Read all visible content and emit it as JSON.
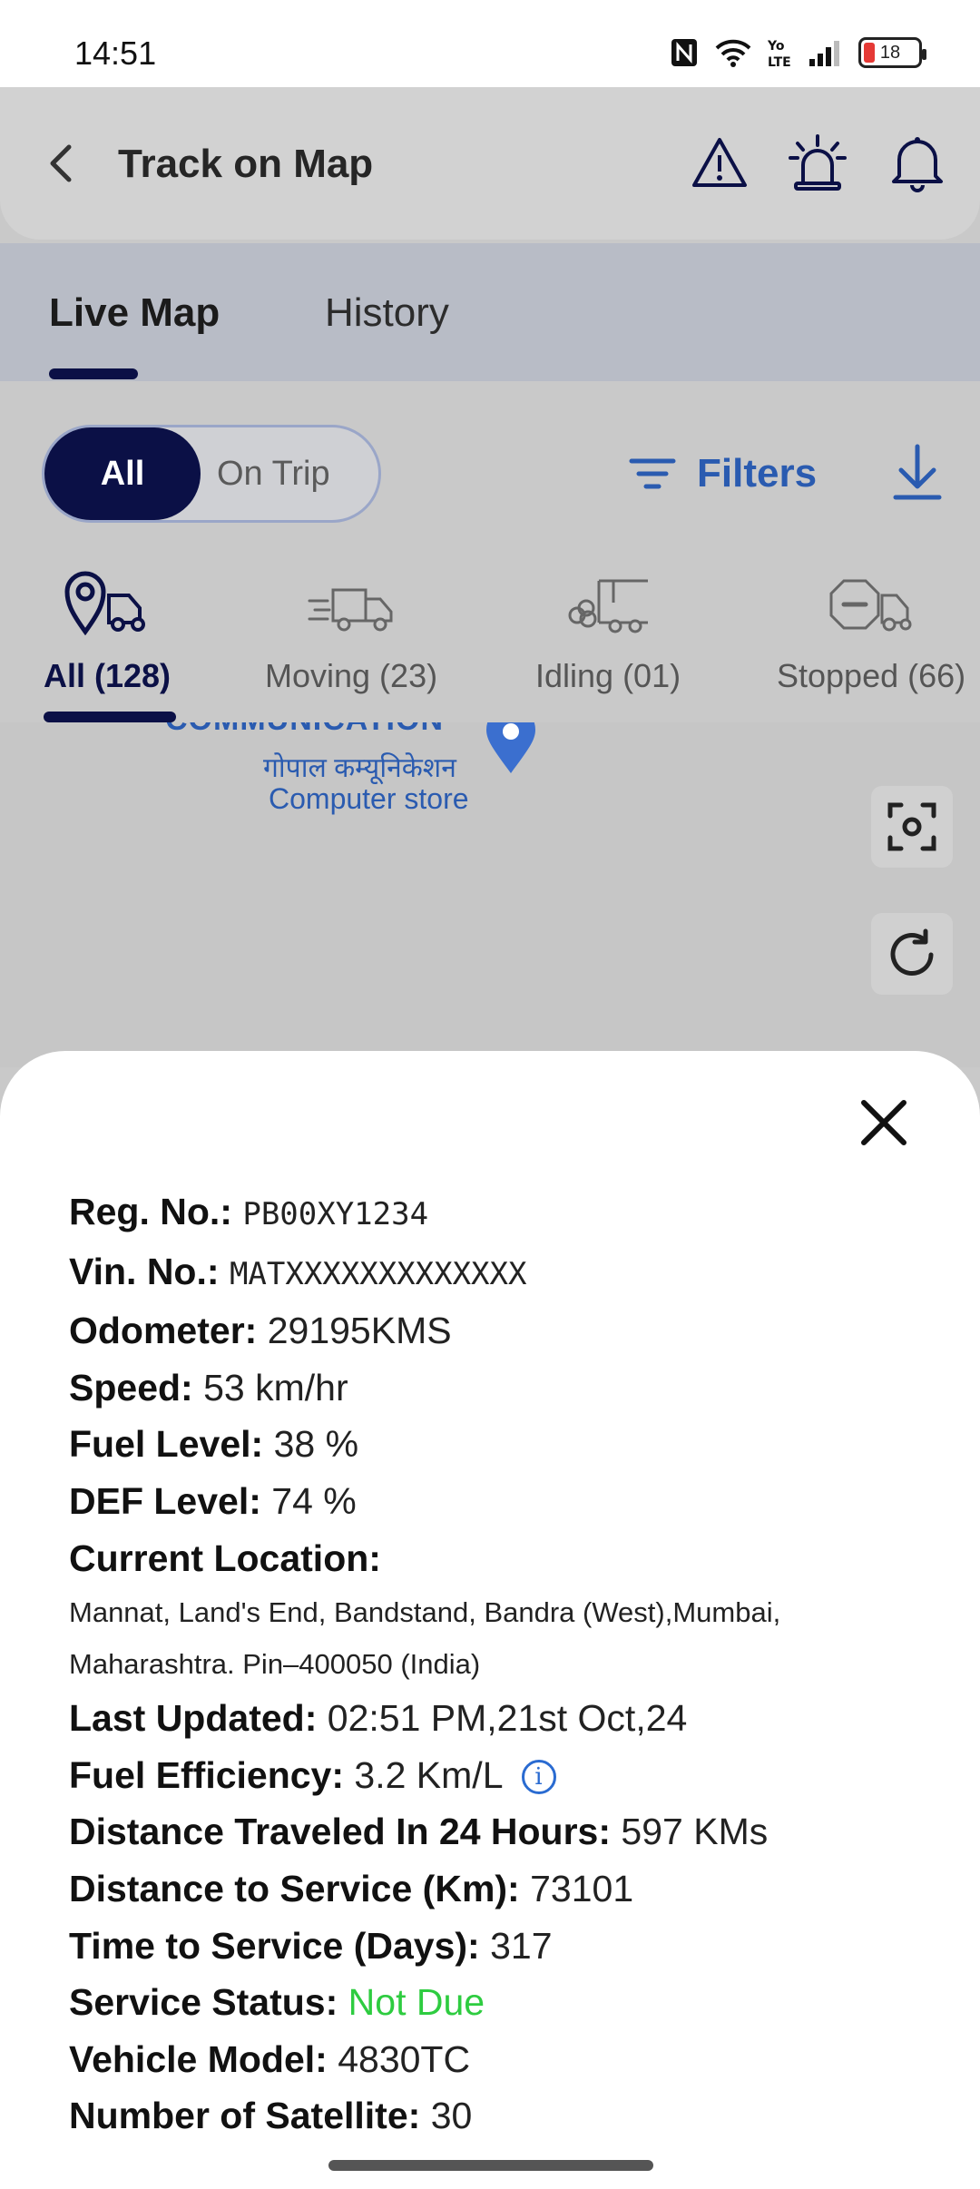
{
  "status_bar": {
    "time": "14:51",
    "battery": "18"
  },
  "header": {
    "title": "Track on Map"
  },
  "tabs": [
    {
      "label": "Live Map"
    },
    {
      "label": "History"
    }
  ],
  "trip_toggle": {
    "all": "All",
    "on_trip": "On Trip"
  },
  "toolbar": {
    "filters": "Filters"
  },
  "vehicle_tabs": [
    {
      "label": "All (128)",
      "icon": "location-truck-icon"
    },
    {
      "label": "Moving (23)",
      "icon": "moving-truck-icon"
    },
    {
      "label": "Idling (01)",
      "icon": "idling-truck-icon"
    },
    {
      "label": "Stopped (66)",
      "icon": "stopped-truck-icon"
    }
  ],
  "map": {
    "place_name": "COMMUNICATION",
    "place_name_hi": "गोपाल कम्यूनिकेशन",
    "place_type": "Computer store"
  },
  "details": {
    "reg_no": {
      "label": "Reg. No.:",
      "value": "PB00XY1234"
    },
    "vin_no": {
      "label": "Vin. No.:",
      "value": "MATXXXXXXXXXXXXX"
    },
    "odometer": {
      "label": "Odometer:",
      "value": "29195KMS"
    },
    "speed": {
      "label": "Speed:",
      "value": "53 km/hr"
    },
    "fuel_level": {
      "label": "Fuel Level:",
      "value": "38 %"
    },
    "def_level": {
      "label": "DEF Level:",
      "value": "74 %"
    },
    "current_location": {
      "label": "Current Location:",
      "line1": "Mannat, Land's End, Bandstand, Bandra (West),Mumbai,",
      "line2": "Maharashtra. Pin–400050 (India)"
    },
    "last_updated": {
      "label": "Last Updated:",
      "value": "02:51 PM,21st Oct,24"
    },
    "fuel_efficiency": {
      "label": "Fuel Efficiency:",
      "value": "3.2 Km/L"
    },
    "distance_24h": {
      "label": "Distance Traveled In 24 Hours:",
      "value": "597 KMs"
    },
    "distance_to_service": {
      "label": "Distance to Service (Km):",
      "value": "73101"
    },
    "time_to_service": {
      "label": "Time to Service (Days):",
      "value": "317"
    },
    "service_status": {
      "label": "Service Status:",
      "value": "Not Due",
      "color": "#2ecc40"
    },
    "vehicle_model": {
      "label": "Vehicle Model:",
      "value": "4830TC"
    },
    "satellites": {
      "label": "Number of Satellite:",
      "value": "30"
    }
  },
  "colors": {
    "accent": "#0b1046",
    "link_blue": "#2a5bb0",
    "status_ok": "#2ecc40"
  }
}
